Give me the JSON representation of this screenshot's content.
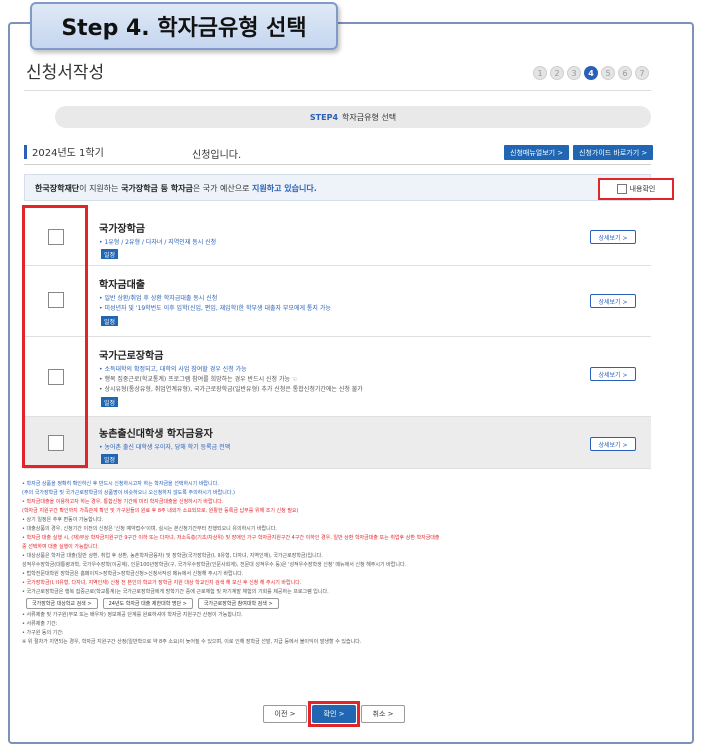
{
  "banner": {
    "title": "Step 4. 학자금유형 선택"
  },
  "page": {
    "title": "신청서작성"
  },
  "steps": [
    "1",
    "2",
    "3",
    "4",
    "5",
    "6",
    "7"
  ],
  "step_bar": {
    "num": "STEP4",
    "label": "학자금유형 선택"
  },
  "semester": {
    "label": "2024년도 1학기",
    "status": "신청입니다."
  },
  "header_buttons": {
    "manual": "신청매뉴얼보기 >",
    "guide": "신청가이드 바로가기 >"
  },
  "notice": {
    "org": "한국장학재단",
    "mid1": "이 지원하는 ",
    "b1": "국가장학금 등 학자금",
    "mid2": "은 국가 예산으로 ",
    "b2": "지원하고 있습니다.",
    "consent": "내용확인"
  },
  "items": [
    {
      "title": "국가장학금",
      "descs": [
        "• 1유형 / 2유형 / 다자녀 / 지역인재 동시 신청"
      ],
      "tag": "일정",
      "detail": "상세보기 >"
    },
    {
      "title": "학자금대출",
      "descs": [
        "• 일반 상환/취업 후 상환 학자금대출 동시 신청",
        "• 미성년자 및 '19학번도 이후 입학(신입, 편입, 재입학)한 학부생 대출자 부모에게 통지 가능"
      ],
      "tag": "일정",
      "detail": "상세보기 >"
    },
    {
      "title": "국가근로장학금",
      "descs": [
        "• 소득대학의 확정되고, 대학의 사업 참여할 경우 신청 가능",
        "• 행복 집중근로(학교통계) 프로그램 참여를 희망하는 경우 반드시 신청 가능 ☜",
        "• 상시유형(통상유형, 취업연계유형), 국가근로장학금(일반유형) 추가 신청은 통합신청기간에는 신청 불가"
      ],
      "tag": "일정",
      "detail": "상세보기 >"
    },
    {
      "title": "농촌출신대학생 학자금융자",
      "descs": [
        "• 농어촌 출신 대학생 우이자, 당해 학기 등록금 전액"
      ],
      "tag": "일정",
      "detail": "상세보기 >"
    }
  ],
  "notes": [
    {
      "c": "blue",
      "t": "• 학자금 상품을 정확히 확인하신 후 반드시 신청하시고자 하는 학자금을 선택하시기 바랍니다."
    },
    {
      "c": "blue",
      "t": "  (주의 국가장학금 및 국가근로장학금의 상품명이 비슷하오니 오신청하지 않도록 주의하시기 바랍니다.)"
    },
    {
      "c": "red",
      "t": "• 학자금대출을 이용하고자 하는 경우, 통합신청 기간에 미리 학자금대출을 신청하시기 바랍니다."
    },
    {
      "c": "red",
      "t": "  (학자금 지원구간 확인까지 가족관계 확인 및 가구원들의 원료 후 8주 내외가 소요되므로, 원활한 등록금 납부를 위해 조기 신청 필요)"
    },
    {
      "c": "gray",
      "t": "• 상기 일정은 추후 변동이 가능합니다."
    },
    {
      "c": "gray",
      "t": "• 대출상품의 경우, 신청기간 이전의 신청은 '신청 예약접수'이며, 실시는 본신청기간부터 진행되오니 유의하시기 바랍니다."
    },
    {
      "c": "red",
      "t": "• 학자금 대출 실행 시, (재)부상 학자금지원구간 9구간 이하 또는 다자녀, 저소득층(기초/차상위) 및 장애인 가구 학자금지원구간 4구간 이하인 경우, 일반 상환 학자금대출 또는 취업후 상환 학자금대출"
    },
    {
      "c": "red",
      "t": "  중 선택하여 대출 실행이 가능합니다."
    },
    {
      "c": "gray",
      "t": "• 대상상품은 학자금 대출(일반 상환, 취업 후 상환, 농촌학자금융자) 및 장학금(국가장학금(I, II유형, 다자녀, 지역인재), 국가근로장학금)입니다."
    },
    {
      "c": "gray",
      "t": "  성적우수장학금(대통령과학, 국가우수장학(이공계), 인문100년장학금(구, 국가우수장학금(인문사회계), 전문대 성적우수 등)은 '성적우수장학생 신청' 메뉴에서 신청 해주시기 바랍니다."
    },
    {
      "c": "gray",
      "t": "• 법학전문대학원 장학금은 홈페이지>장학금>장학금신청>신청서작성 메뉴에서 신청해 주시기 바랍니다."
    },
    {
      "c": "red",
      "t": "• 국가장학금(I, II유형, 다자녀, 지역인재) 신청 전 본인의 학교가 장학금 지원 대상 학교인지 검색 해 보신 후 신청 해 주시기 바랍니다."
    },
    {
      "c": "gray",
      "t": "• 국가근로장학금은 행복 집중근로(학교통계)는 국가근로장학금에게 방학기간 중에 근로체험 및 자기계발 체험의 기회를 제공하는 프로그램 입니다."
    }
  ],
  "links": [
    "국가장학금 대상학교 검색 >",
    "24년도 학자금 대출 제한대학 명단 >",
    "국가근로장학금 참여대학 검색 >"
  ],
  "notes_after": [
    {
      "c": "gray",
      "t": "• 서류제출 및 가구원(부모 또는 배우자) 정보제공 단계를 완료하셔야 학자금 지원구간 산정이 가능합니다."
    },
    {
      "c": "gray",
      "t": "• 서류제출 기간:"
    },
    {
      "c": "gray",
      "t": "• 가구원 동의 기간:"
    },
    {
      "c": "gray",
      "t": "  ※ 위 절차가 지연되는 경우, 학자금 지원구간 산정(일반학으로 약 8주 소요)이 늦어질 수 있으며, 이로 인해 장학금 선발, 지급 등에서 불이익이 발생할 수 있습니다."
    }
  ],
  "buttons": {
    "prev": "이전 >",
    "confirm": "확인 >",
    "cancel": "취소 >"
  },
  "colors": {
    "accent": "#2166b2",
    "highlight": "#e3242b"
  }
}
